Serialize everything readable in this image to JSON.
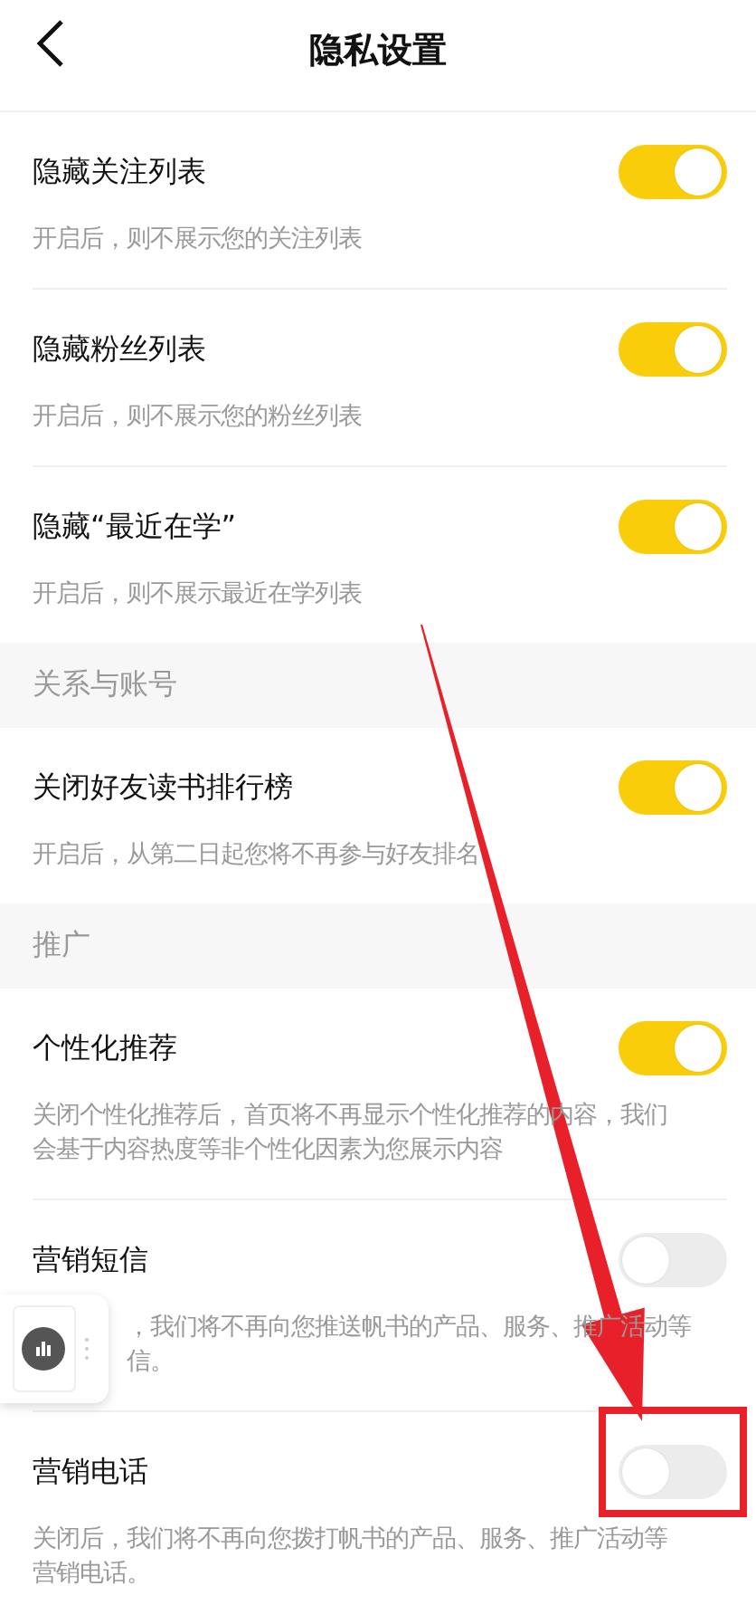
{
  "header": {
    "title": "隐私设置"
  },
  "sections": [
    {
      "items": [
        {
          "label": "隐藏关注列表",
          "on": true,
          "highlighted": false,
          "description": [
            "开启后，则不展示您的关注列表"
          ]
        },
        {
          "label": "隐藏粉丝列表",
          "on": true,
          "highlighted": false,
          "description": [
            "开启后，则不展示您的粉丝列表"
          ]
        },
        {
          "label": "隐藏“最近在学”",
          "on": true,
          "highlighted": false,
          "description": [
            "开启后，则不展示最近在学列表"
          ]
        }
      ]
    },
    {
      "title": "关系与账号",
      "items": [
        {
          "label": "关闭好友读书排行榜",
          "on": true,
          "highlighted": false,
          "description": [
            "开启后，从第二日起您将不再参与好友排名"
          ]
        }
      ]
    },
    {
      "title": "推广",
      "items": [
        {
          "label": "个性化推荐",
          "on": true,
          "highlighted": false,
          "description": [
            "关闭个性化推荐后，首页将不再显示个性化推荐的内容，我们",
            "会基于内容热度等非个性化因素为您展示内容"
          ]
        },
        {
          "label": "营销短信",
          "on": false,
          "highlighted": false,
          "covered": true,
          "description": [
            "，我们将不再向您推送帆书的产品、服务、推广活动等",
            "信。"
          ]
        },
        {
          "label": "营销电话",
          "on": false,
          "highlighted": true,
          "description": [
            "关闭后，我们将不再向您拨打帆书的产品、服务、推广活动等",
            "营销电话。"
          ]
        }
      ]
    }
  ]
}
